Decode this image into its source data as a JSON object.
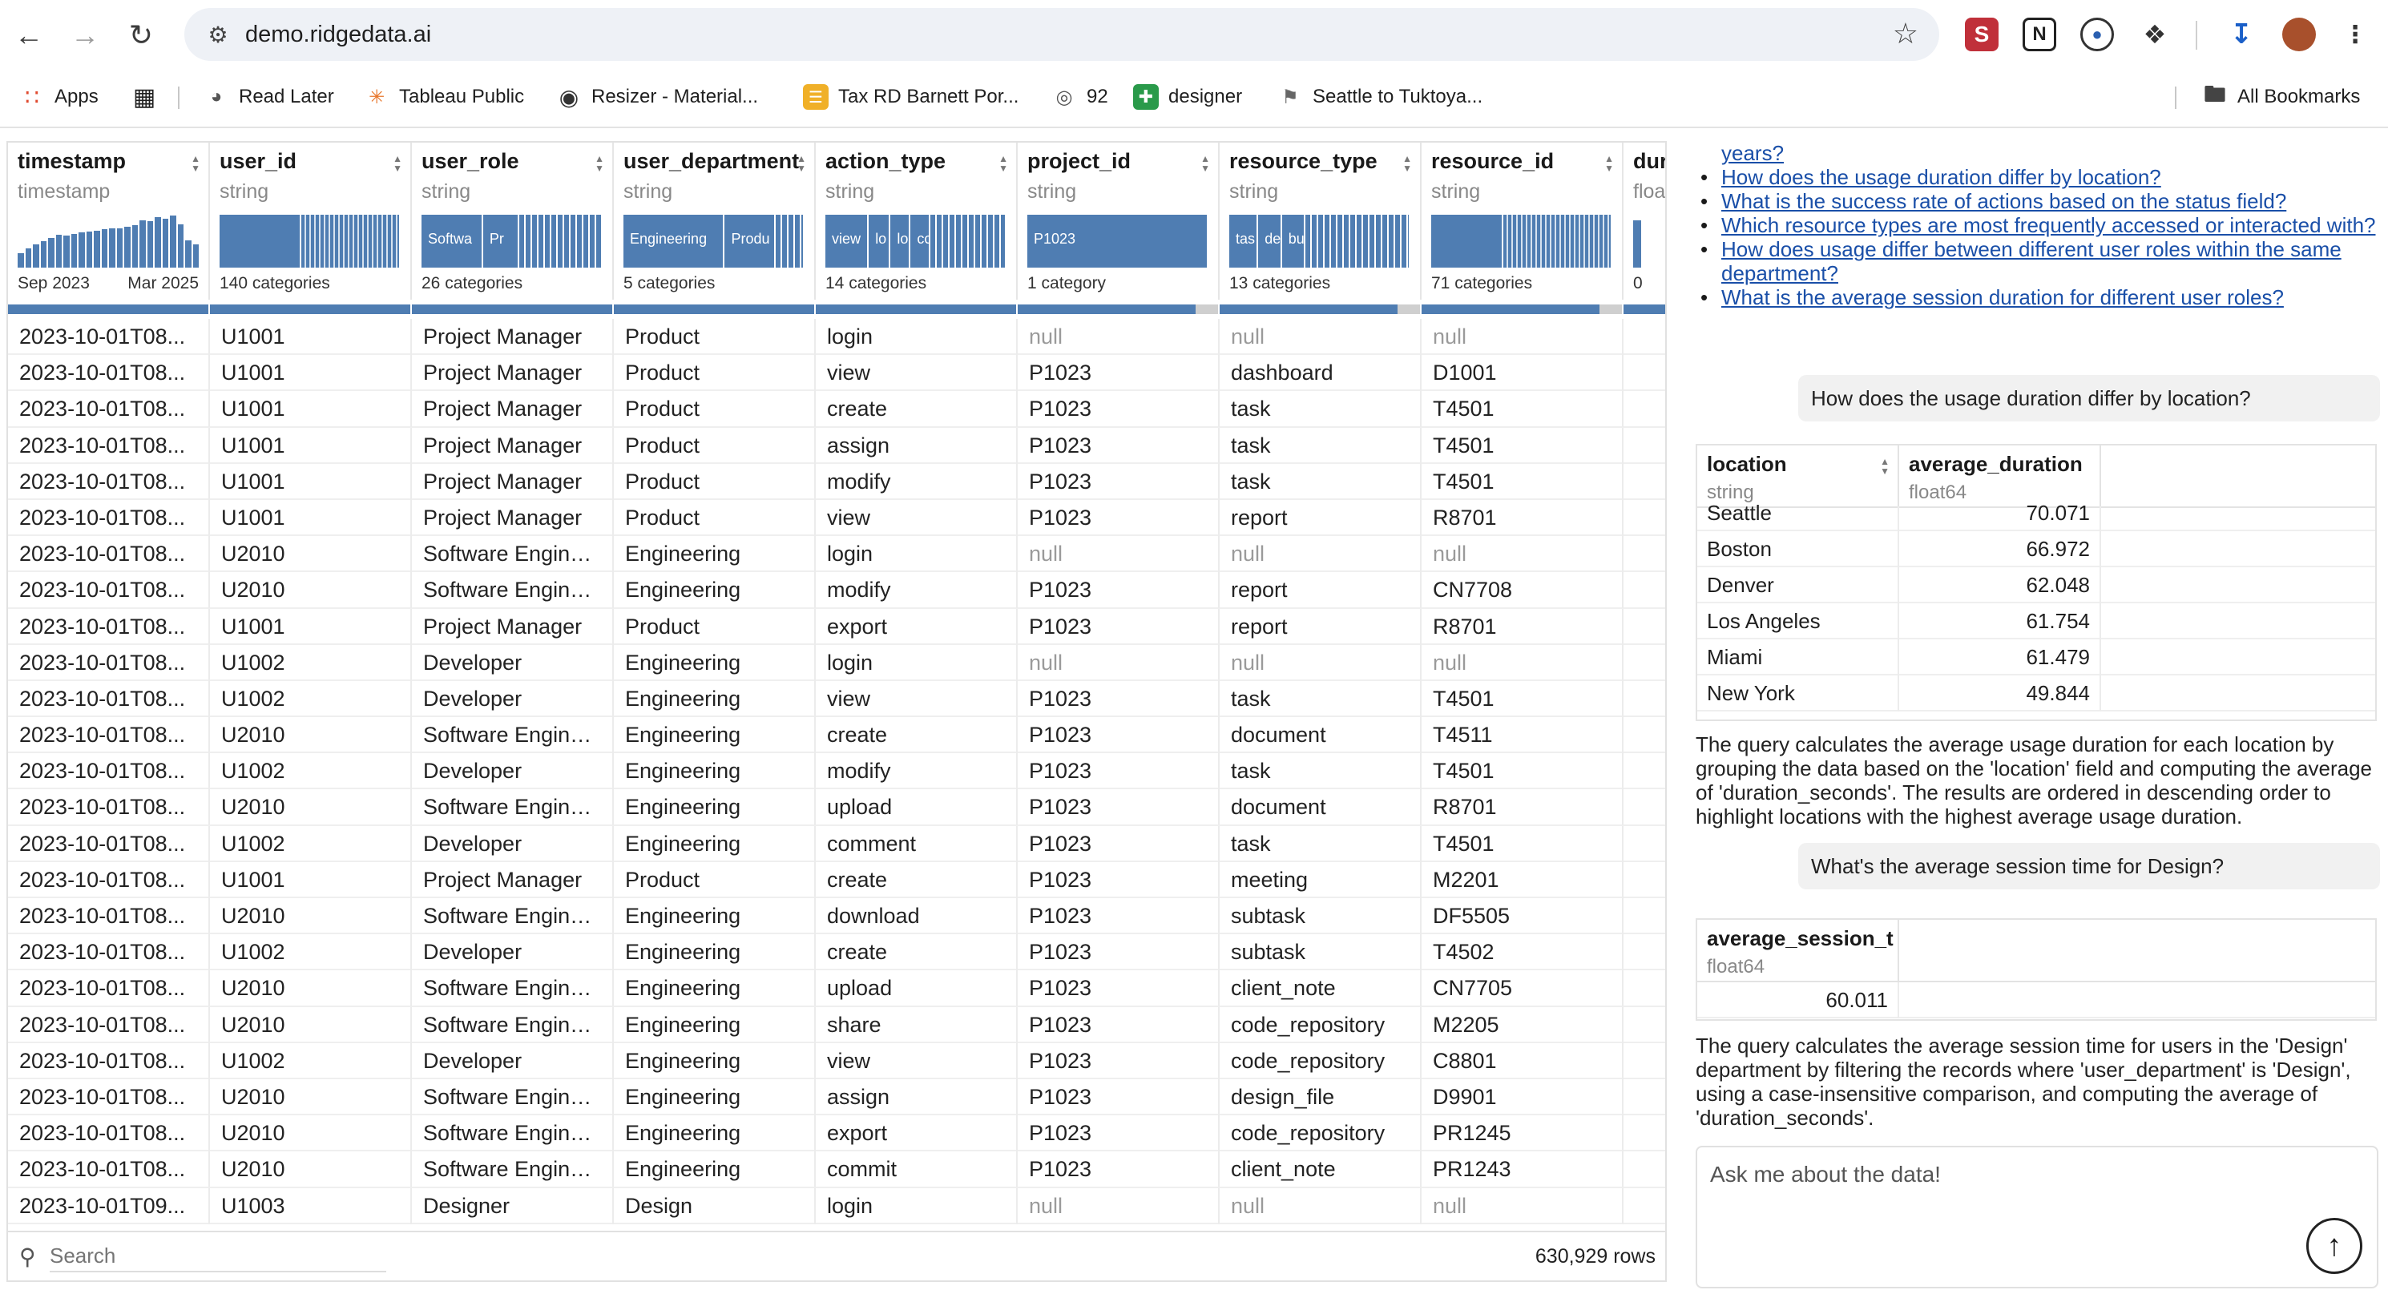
{
  "browser": {
    "url": "demo.ridgedata.ai",
    "bookmarks": [
      {
        "label": "Apps",
        "icon": "apps-grid-icon"
      },
      {
        "label": "",
        "icon": "tab-groups-icon"
      },
      {
        "label": "Read Later",
        "icon": "read-later-icon"
      },
      {
        "label": "Tableau Public",
        "icon": "tableau-icon"
      },
      {
        "label": "Resizer - Material...",
        "icon": "resizer-icon"
      },
      {
        "label": "Tax RD Barnett Por...",
        "icon": "tax-icon"
      },
      {
        "label": "92",
        "icon": "counter-icon"
      },
      {
        "label": "designer",
        "icon": "designer-icon"
      },
      {
        "label": "Seattle to Tuktoya...",
        "icon": "route-icon"
      }
    ],
    "all_bookmarks": "All Bookmarks"
  },
  "table": {
    "columns": [
      {
        "name": "timestamp",
        "type": "timestamp",
        "footer_left": "Sep 2023",
        "footer_right": "Mar 2025",
        "kind": "histogram",
        "hist": [
          0.28,
          0.36,
          0.44,
          0.5,
          0.56,
          0.62,
          0.6,
          0.64,
          0.66,
          0.68,
          0.7,
          0.72,
          0.74,
          0.75,
          0.78,
          0.8,
          0.9,
          0.88,
          0.95,
          0.92,
          0.99,
          0.82,
          0.52,
          0.44
        ]
      },
      {
        "name": "user_id",
        "type": "string",
        "footer_left": "140 categories",
        "kind": "categories",
        "segments": [
          {
            "label": "",
            "w": 0.45
          },
          {
            "label": "",
            "w": 0.55,
            "fade": true
          }
        ]
      },
      {
        "name": "user_role",
        "type": "string",
        "footer_left": "26 categories",
        "kind": "categories",
        "segments": [
          {
            "label": "Softwa",
            "w": 0.34
          },
          {
            "label": "Pr",
            "w": 0.2
          },
          {
            "label": "",
            "w": 0.46,
            "stripes": true
          }
        ]
      },
      {
        "name": "user_department",
        "type": "string",
        "footer_left": "5 categories",
        "kind": "categories",
        "segments": [
          {
            "label": "Engineering",
            "w": 0.56
          },
          {
            "label": "Produ",
            "w": 0.28
          },
          {
            "label": "",
            "w": 0.16,
            "stripes": true
          }
        ]
      },
      {
        "name": "action_type",
        "type": "string",
        "footer_left": "14 categories",
        "kind": "categories",
        "segments": [
          {
            "label": "view",
            "w": 0.24
          },
          {
            "label": "lo",
            "w": 0.12
          },
          {
            "label": "lo",
            "w": 0.11
          },
          {
            "label": "cc",
            "w": 0.11
          },
          {
            "label": "",
            "w": 0.42,
            "stripes": true
          }
        ]
      },
      {
        "name": "project_id",
        "type": "string",
        "footer_left": "1 category",
        "kind": "categories",
        "segments": [
          {
            "label": "P1023",
            "w": 1.0
          }
        ],
        "null_frac": 0.11
      },
      {
        "name": "resource_type",
        "type": "string",
        "footer_left": "13 categories",
        "kind": "categories",
        "segments": [
          {
            "label": "tas",
            "w": 0.16
          },
          {
            "label": "de",
            "w": 0.13
          },
          {
            "label": "bu",
            "w": 0.13
          },
          {
            "label": "",
            "w": 0.58,
            "stripes": true
          }
        ],
        "null_frac": 0.11
      },
      {
        "name": "resource_id",
        "type": "string",
        "footer_left": "71 categories",
        "kind": "categories",
        "segments": [
          {
            "label": "",
            "w": 0.4
          },
          {
            "label": "",
            "w": 0.6,
            "fade": true
          }
        ],
        "null_frac": 0.11
      },
      {
        "name": "dur",
        "type": "floa",
        "footer_left": "0",
        "kind": "histogram",
        "hist": [
          0.9
        ]
      }
    ],
    "rows": [
      [
        "2023-10-01T08...",
        "U1001",
        "Project Manager",
        "Product",
        "login",
        "null",
        "null",
        "null"
      ],
      [
        "2023-10-01T08...",
        "U1001",
        "Project Manager",
        "Product",
        "view",
        "P1023",
        "dashboard",
        "D1001"
      ],
      [
        "2023-10-01T08...",
        "U1001",
        "Project Manager",
        "Product",
        "create",
        "P1023",
        "task",
        "T4501"
      ],
      [
        "2023-10-01T08...",
        "U1001",
        "Project Manager",
        "Product",
        "assign",
        "P1023",
        "task",
        "T4501"
      ],
      [
        "2023-10-01T08...",
        "U1001",
        "Project Manager",
        "Product",
        "modify",
        "P1023",
        "task",
        "T4501"
      ],
      [
        "2023-10-01T08...",
        "U1001",
        "Project Manager",
        "Product",
        "view",
        "P1023",
        "report",
        "R8701"
      ],
      [
        "2023-10-01T08...",
        "U2010",
        "Software Engineer",
        "Engineering",
        "login",
        "null",
        "null",
        "null"
      ],
      [
        "2023-10-01T08...",
        "U2010",
        "Software Engineer",
        "Engineering",
        "modify",
        "P1023",
        "report",
        "CN7708"
      ],
      [
        "2023-10-01T08...",
        "U1001",
        "Project Manager",
        "Product",
        "export",
        "P1023",
        "report",
        "R8701"
      ],
      [
        "2023-10-01T08...",
        "U1002",
        "Developer",
        "Engineering",
        "login",
        "null",
        "null",
        "null"
      ],
      [
        "2023-10-01T08...",
        "U1002",
        "Developer",
        "Engineering",
        "view",
        "P1023",
        "task",
        "T4501"
      ],
      [
        "2023-10-01T08...",
        "U2010",
        "Software Engineer",
        "Engineering",
        "create",
        "P1023",
        "document",
        "T4511"
      ],
      [
        "2023-10-01T08...",
        "U1002",
        "Developer",
        "Engineering",
        "modify",
        "P1023",
        "task",
        "T4501"
      ],
      [
        "2023-10-01T08...",
        "U2010",
        "Software Engineer",
        "Engineering",
        "upload",
        "P1023",
        "document",
        "R8701"
      ],
      [
        "2023-10-01T08...",
        "U1002",
        "Developer",
        "Engineering",
        "comment",
        "P1023",
        "task",
        "T4501"
      ],
      [
        "2023-10-01T08...",
        "U1001",
        "Project Manager",
        "Product",
        "create",
        "P1023",
        "meeting",
        "M2201"
      ],
      [
        "2023-10-01T08...",
        "U2010",
        "Software Engineer",
        "Engineering",
        "download",
        "P1023",
        "subtask",
        "DF5505"
      ],
      [
        "2023-10-01T08...",
        "U1002",
        "Developer",
        "Engineering",
        "create",
        "P1023",
        "subtask",
        "T4502"
      ],
      [
        "2023-10-01T08...",
        "U2010",
        "Software Engineer",
        "Engineering",
        "upload",
        "P1023",
        "client_note",
        "CN7705"
      ],
      [
        "2023-10-01T08...",
        "U2010",
        "Software Engineer",
        "Engineering",
        "share",
        "P1023",
        "code_repository",
        "M2205"
      ],
      [
        "2023-10-01T08...",
        "U1002",
        "Developer",
        "Engineering",
        "view",
        "P1023",
        "code_repository",
        "C8801"
      ],
      [
        "2023-10-01T08...",
        "U2010",
        "Software Engineer",
        "Engineering",
        "assign",
        "P1023",
        "design_file",
        "D9901"
      ],
      [
        "2023-10-01T08...",
        "U2010",
        "Software Engineer",
        "Engineering",
        "export",
        "P1023",
        "code_repository",
        "PR1245"
      ],
      [
        "2023-10-01T08...",
        "U2010",
        "Software Engineer",
        "Engineering",
        "commit",
        "P1023",
        "client_note",
        "PR1243"
      ],
      [
        "2023-10-01T09...",
        "U1003",
        "Designer",
        "Design",
        "login",
        "null",
        "null",
        "null"
      ]
    ],
    "search_placeholder": "Search",
    "row_count": "630,929 rows"
  },
  "chat": {
    "suggestions": [
      "years?",
      "How does the usage duration differ by location?",
      "What is the success rate of actions based on the status field?",
      "Which resource types are most frequently accessed or interacted with?",
      "How does usage differ between different user roles within the same department?",
      "What is the average session duration for different user roles?"
    ],
    "q1": "How does the usage duration differ by location?",
    "result1": {
      "headers": [
        {
          "name": "location",
          "type": "string"
        },
        {
          "name": "average_duration",
          "type": "float64"
        }
      ],
      "rows": [
        [
          "Seattle",
          "70.071"
        ],
        [
          "Boston",
          "66.972"
        ],
        [
          "Denver",
          "62.048"
        ],
        [
          "Los Angeles",
          "61.754"
        ],
        [
          "Miami",
          "61.479"
        ],
        [
          "New York",
          "49.844"
        ]
      ]
    },
    "explain1": "The query calculates the average usage duration for each location by grouping the data based on the 'location' field and computing the average of 'duration_seconds'. The results are ordered in descending order to highlight locations with the highest average usage duration.",
    "q2": "What's the average session time for Design?",
    "result2": {
      "headers": [
        {
          "name": "average_session_t",
          "type": "float64"
        }
      ],
      "rows": [
        [
          "60.011"
        ]
      ]
    },
    "explain2": "The query calculates the average session time for users in the 'Design' department by filtering the records where 'user_department' is 'Design', using a case-insensitive comparison, and computing the average of 'duration_seconds'.",
    "input_placeholder": "Ask me about the data!"
  },
  "colors": {
    "accent": "#4f7db2",
    "link": "#1a4fa8"
  }
}
